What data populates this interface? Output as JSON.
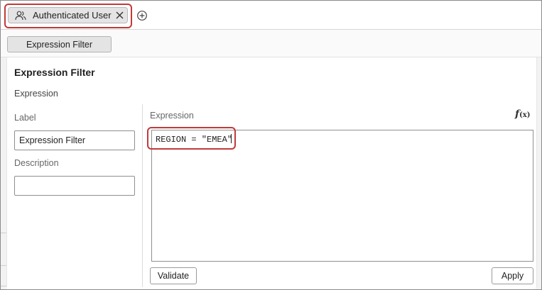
{
  "role_tab": {
    "label": "Authenticated User",
    "icon": "users-icon",
    "close_icon": "close-icon"
  },
  "add_tab_icon": "plus-circle-icon",
  "filter_tab": {
    "label": "Expression Filter"
  },
  "panel": {
    "title": "Expression Filter",
    "section": "Expression",
    "label_field": {
      "label": "Label",
      "value": "Expression Filter"
    },
    "description_field": {
      "label": "Description",
      "value": ""
    },
    "expression": {
      "label": "Expression",
      "function_icon": "fx-icon",
      "value": "REGION = \"EMEA\""
    },
    "validate_label": "Validate",
    "apply_label": "Apply"
  },
  "colors": {
    "highlight": "#c13a3a",
    "chip_bg": "#e4e4e4"
  }
}
